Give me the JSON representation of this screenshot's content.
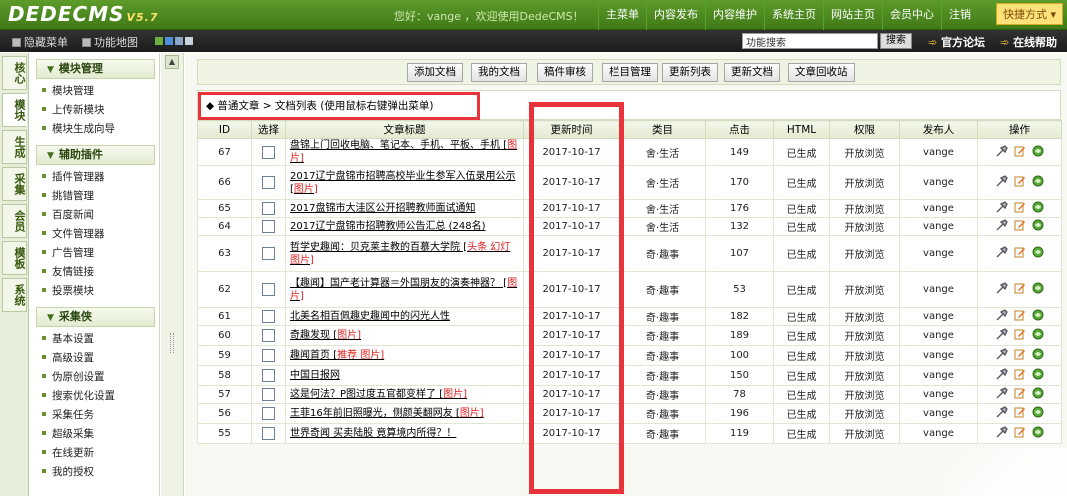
{
  "header": {
    "logo": "DEDECMS",
    "version": "V5.7",
    "welcome": "您好：vange ，欢迎使用DedeCMS！",
    "nav": [
      "主菜单",
      "内容发布",
      "内容维护",
      "系统主页",
      "网站主页",
      "会员中心",
      "注销"
    ],
    "quick_menu": "快捷方式"
  },
  "subbar": {
    "hide_menu": "隐藏菜单",
    "func_map": "功能地图",
    "search_placeholder": "功能搜索",
    "search_button": "搜索",
    "forum": "官方论坛",
    "help": "在线帮助"
  },
  "vtabs": [
    "核心",
    "模块",
    "生成",
    "采集",
    "会员",
    "模板",
    "系统"
  ],
  "sidebar": {
    "groups": [
      {
        "title": "模块管理",
        "items": [
          "模块管理",
          "上传新模块",
          "模块生成向导"
        ]
      },
      {
        "title": "辅助插件",
        "items": [
          "插件管理器",
          "挑错管理",
          "百度新闻",
          "文件管理器",
          "广告管理",
          "友情链接",
          "投票模块"
        ]
      },
      {
        "title": "采集侠",
        "items": [
          "基本设置",
          "高级设置",
          "伪原创设置",
          "搜索优化设置",
          "采集任务",
          "超级采集",
          "在线更新",
          "我的授权"
        ]
      }
    ]
  },
  "toolbar": {
    "buttons": [
      "添加文档",
      "我的文档",
      "稿件审核",
      "栏目管理",
      "更新列表",
      "更新文档",
      "文章回收站"
    ]
  },
  "breadcrumb": {
    "text": "◆  普通文章 > 文档列表  (使用鼠标右键弹出菜单)"
  },
  "table": {
    "headers": [
      "ID",
      "选择",
      "文章标题",
      "更新时间",
      "类目",
      "点击",
      "HTML",
      "权限",
      "发布人",
      "操作"
    ],
    "rows": [
      {
        "id": "67",
        "title": "盘锦上门回收电脑、笔记本、手机、平板、手机 [",
        "tag": "图片]",
        "time": "2017-10-17",
        "cat": "舍·生活",
        "clicks": "149",
        "html": "已生成",
        "perm": "开放浏览",
        "user": "vange"
      },
      {
        "id": "66",
        "title": "2017辽宁盘锦市招聘高校毕业生参军入伍录用公示 [",
        "tag": "图片]",
        "time": "2017-10-17",
        "cat": "舍·生活",
        "clicks": "170",
        "html": "已生成",
        "perm": "开放浏览",
        "user": "vange"
      },
      {
        "id": "65",
        "title": "2017盘锦市大洼区公开招聘教师面试通知",
        "tag": "",
        "time": "2017-10-17",
        "cat": "舍·生活",
        "clicks": "176",
        "html": "已生成",
        "perm": "开放浏览",
        "user": "vange"
      },
      {
        "id": "64",
        "title": "2017辽宁盘锦市招聘教师公告汇总 (248名)",
        "tag": "",
        "time": "2017-10-17",
        "cat": "舍·生活",
        "clicks": "132",
        "html": "已生成",
        "perm": "开放浏览",
        "user": "vange"
      },
      {
        "id": "63",
        "title": "哲学史趣闻：贝克莱主教的百慕大学院 [",
        "tag": "头条 幻灯 图片]",
        "time": "2017-10-17",
        "cat": "奇·趣事",
        "clicks": "107",
        "html": "已生成",
        "perm": "开放浏览",
        "user": "vange"
      },
      {
        "id": "62",
        "title": "【趣闻】国产老计算器＝外国朋友的演奏神器？ [",
        "tag": "图片]",
        "time": "2017-10-17",
        "cat": "奇·趣事",
        "clicks": "53",
        "html": "已生成",
        "perm": "开放浏览",
        "user": "vange"
      },
      {
        "id": "61",
        "title": "北美名相百佩趣史趣闻中的闪光人性",
        "tag": "",
        "time": "2017-10-17",
        "cat": "奇·趣事",
        "clicks": "182",
        "html": "已生成",
        "perm": "开放浏览",
        "user": "vange"
      },
      {
        "id": "60",
        "title": "奇趣发现 [",
        "tag": "图片]",
        "time": "2017-10-17",
        "cat": "奇·趣事",
        "clicks": "189",
        "html": "已生成",
        "perm": "开放浏览",
        "user": "vange"
      },
      {
        "id": "59",
        "title": "趣闻首页 [",
        "tag": "推荐 图片]",
        "time": "2017-10-17",
        "cat": "奇·趣事",
        "clicks": "100",
        "html": "已生成",
        "perm": "开放浏览",
        "user": "vange"
      },
      {
        "id": "58",
        "title": "中国日报网",
        "tag": "",
        "time": "2017-10-17",
        "cat": "奇·趣事",
        "clicks": "150",
        "html": "已生成",
        "perm": "开放浏览",
        "user": "vange"
      },
      {
        "id": "57",
        "title": "这是何法？P图过度五官都变样了 [",
        "tag": "图片]",
        "time": "2017-10-17",
        "cat": "奇·趣事",
        "clicks": "78",
        "html": "已生成",
        "perm": "开放浏览",
        "user": "vange"
      },
      {
        "id": "56",
        "title": "王菲16年前旧照曝光，侧颜美翻网友 [",
        "tag": "图片]",
        "time": "2017-10-17",
        "cat": "奇·趣事",
        "clicks": "196",
        "html": "已生成",
        "perm": "开放浏览",
        "user": "vange"
      },
      {
        "id": "55",
        "title": "世界奇闻 买卖陆股 竟算境内所得？！",
        "tag": "",
        "time": "2017-10-17",
        "cat": "奇·趣事",
        "clicks": "119",
        "html": "已生成",
        "perm": "开放浏览",
        "user": "vange"
      }
    ]
  },
  "colors": {
    "accent_red": "#e8333a",
    "brand_green": "#4a8a1e",
    "tag_red": "#e02020"
  },
  "icons": [
    "move-icon",
    "edit-icon",
    "view-icon"
  ]
}
